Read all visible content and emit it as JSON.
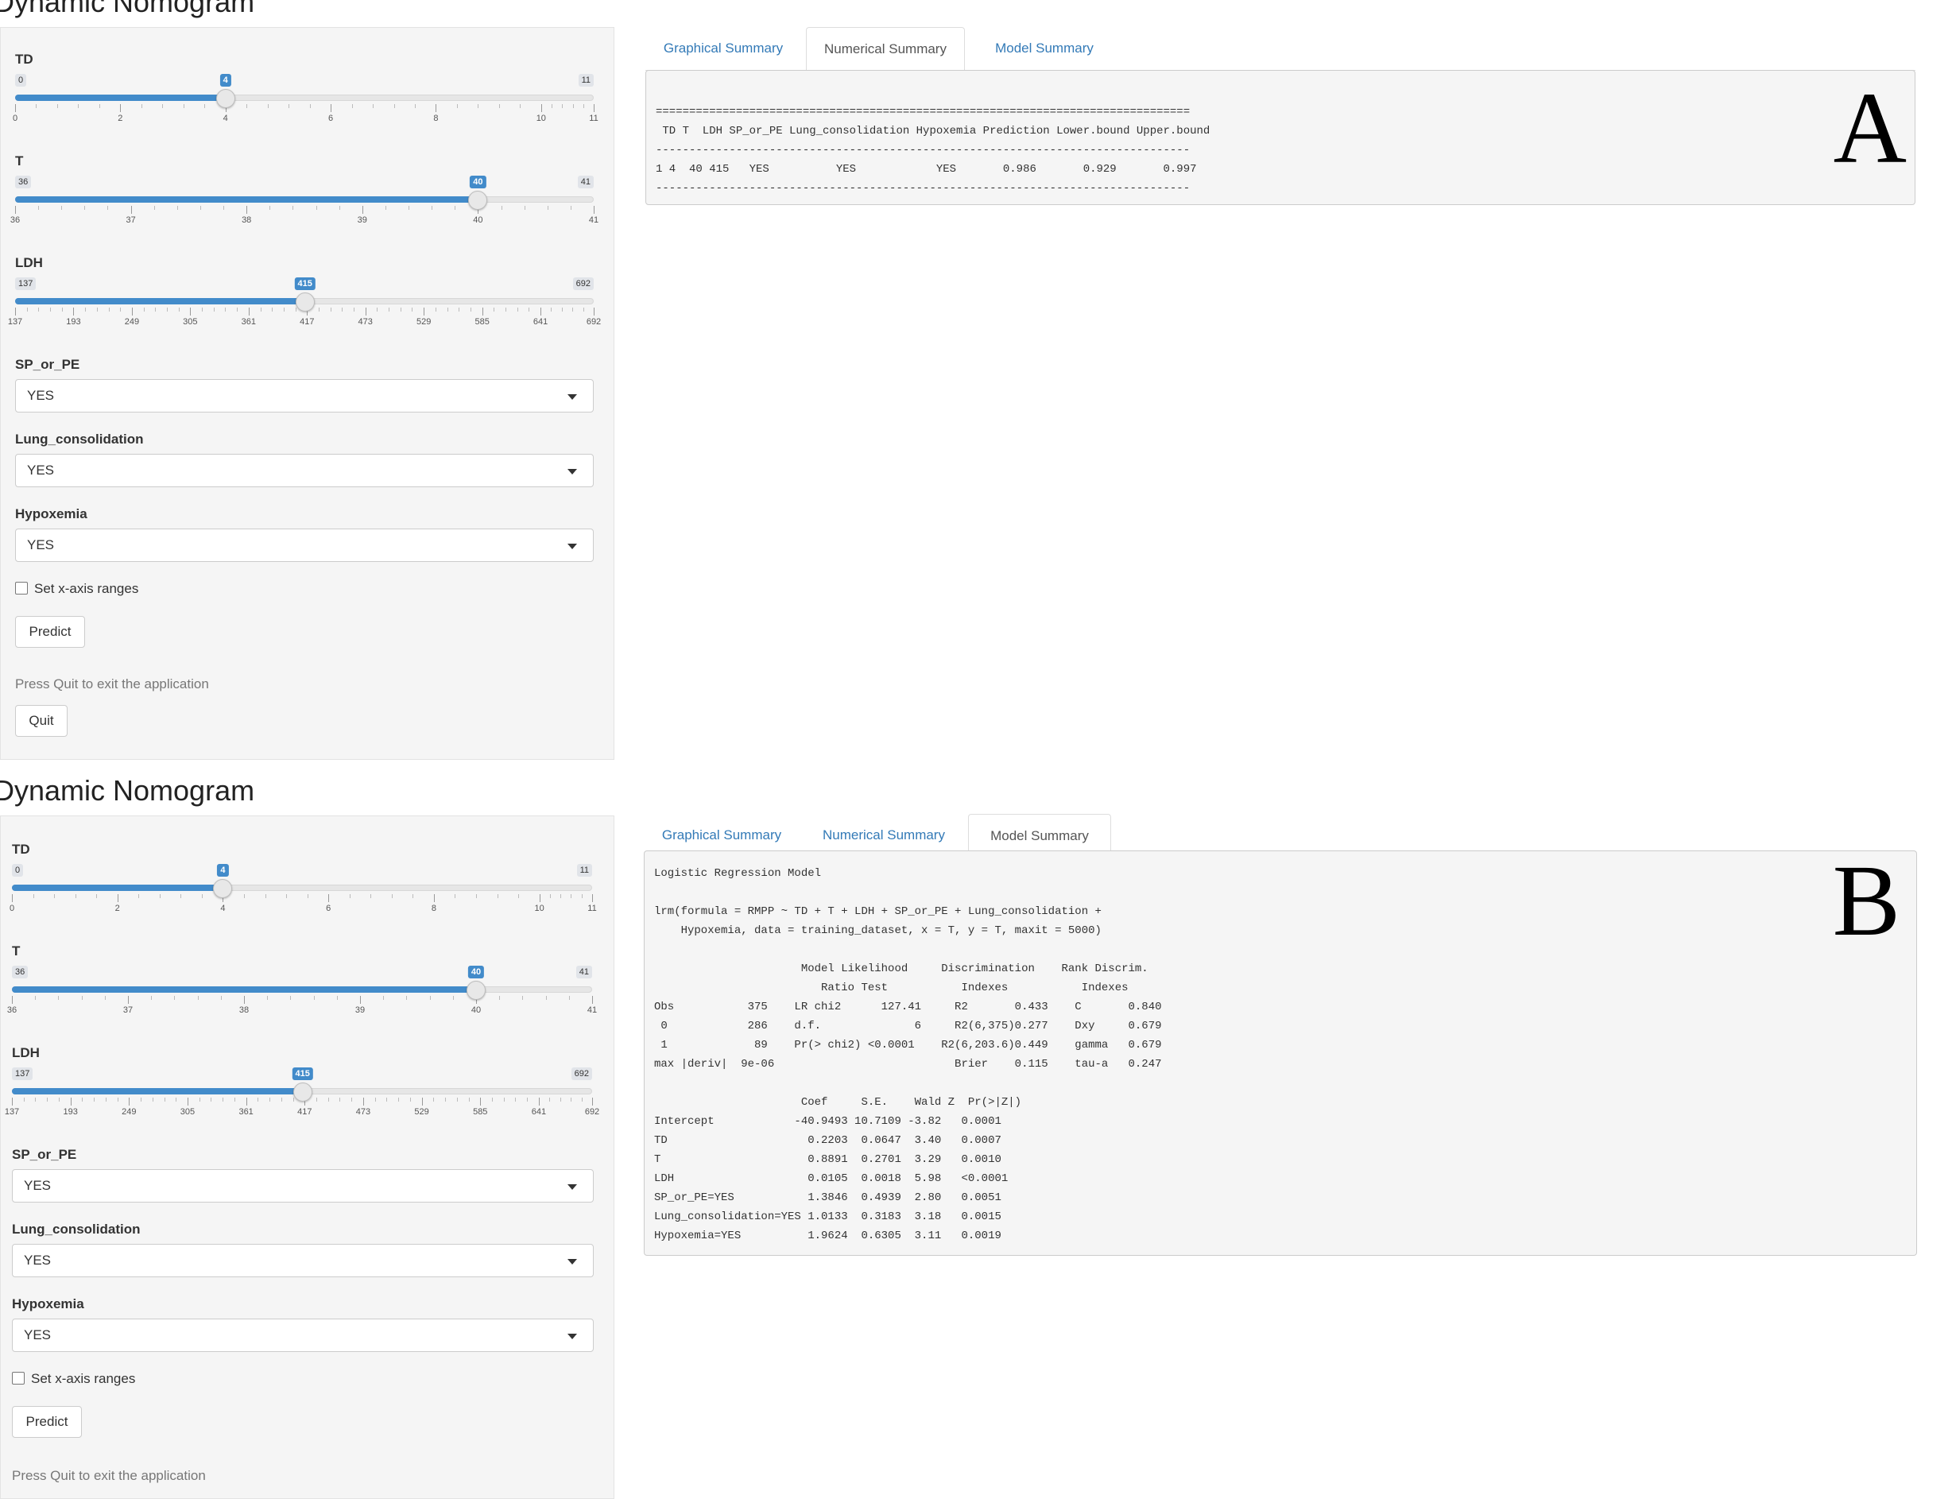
{
  "panels": [
    {
      "app_title": "Dynamic Nomogram",
      "letter": "A",
      "sliders": [
        {
          "label": "TD",
          "min": 0,
          "max": 11,
          "value": 4,
          "tick_labels": [
            "0",
            "2",
            "4",
            "6",
            "8",
            "10",
            "11"
          ]
        },
        {
          "label": "T",
          "min": 36,
          "max": 41,
          "value": 40,
          "tick_labels": [
            "36",
            "37",
            "38",
            "39",
            "40",
            "41"
          ]
        },
        {
          "label": "LDH",
          "min": 137,
          "max": 692,
          "value": 415,
          "tick_labels": [
            "137",
            "193",
            "249",
            "305",
            "361",
            "417",
            "473",
            "529",
            "585",
            "641",
            "692"
          ]
        }
      ],
      "selects": [
        {
          "label": "SP_or_PE",
          "value": "YES"
        },
        {
          "label": "Lung_consolidation",
          "value": "YES"
        },
        {
          "label": "Hypoxemia",
          "value": "YES"
        }
      ],
      "checkbox_label": "Set x-axis ranges",
      "predict_label": "Predict",
      "quit_help": "Press Quit to exit the application",
      "quit_label": "Quit",
      "tabs": [
        "Graphical Summary",
        "Numerical Summary",
        "Model Summary"
      ],
      "active_tab": 1,
      "output": "================================================================================\n TD T  LDH SP_or_PE Lung_consolidation Hypoxemia Prediction Lower.bound Upper.bound\n--------------------------------------------------------------------------------\n1 4  40 415   YES          YES            YES       0.986       0.929       0.997\n--------------------------------------------------------------------------------"
    },
    {
      "app_title": "Dynamic Nomogram",
      "letter": "B",
      "sliders": [
        {
          "label": "TD",
          "min": 0,
          "max": 11,
          "value": 4,
          "tick_labels": [
            "0",
            "2",
            "4",
            "6",
            "8",
            "10",
            "11"
          ]
        },
        {
          "label": "T",
          "min": 36,
          "max": 41,
          "value": 40,
          "tick_labels": [
            "36",
            "37",
            "38",
            "39",
            "40",
            "41"
          ]
        },
        {
          "label": "LDH",
          "min": 137,
          "max": 692,
          "value": 415,
          "tick_labels": [
            "137",
            "193",
            "249",
            "305",
            "361",
            "417",
            "473",
            "529",
            "585",
            "641",
            "692"
          ]
        }
      ],
      "selects": [
        {
          "label": "SP_or_PE",
          "value": "YES"
        },
        {
          "label": "Lung_consolidation",
          "value": "YES"
        },
        {
          "label": "Hypoxemia",
          "value": "YES"
        }
      ],
      "checkbox_label": "Set x-axis ranges",
      "predict_label": "Predict",
      "quit_help": "Press Quit to exit the application",
      "quit_label": "",
      "tabs": [
        "Graphical Summary",
        "Numerical Summary",
        "Model Summary"
      ],
      "active_tab": 2,
      "output": "Logistic Regression Model\n\nlrm(formula = RMPP ~ TD + T + LDH + SP_or_PE + Lung_consolidation +\n    Hypoxemia, data = training_dataset, x = T, y = T, maxit = 5000)\n\n                      Model Likelihood     Discrimination    Rank Discrim.\n                         Ratio Test           Indexes           Indexes\nObs           375    LR chi2      127.41     R2       0.433    C       0.840\n 0            286    d.f.              6     R2(6,375)0.277    Dxy     0.679\n 1             89    Pr(> chi2) <0.0001    R2(6,203.6)0.449    gamma   0.679\nmax |deriv|  9e-06                           Brier    0.115    tau-a   0.247\n\n                      Coef     S.E.    Wald Z  Pr(>|Z|)\nIntercept            -40.9493 10.7109 -3.82   0.0001\nTD                     0.2203  0.0647  3.40   0.0007\nT                      0.8891  0.2701  3.29   0.0010\nLDH                    0.0105  0.0018  5.98   <0.0001\nSP_or_PE=YES           1.3846  0.4939  2.80   0.0051\nLung_consolidation=YES 1.0133  0.3183  3.18   0.0015\nHypoxemia=YES          1.9624  0.6305  3.11   0.0019"
    }
  ]
}
